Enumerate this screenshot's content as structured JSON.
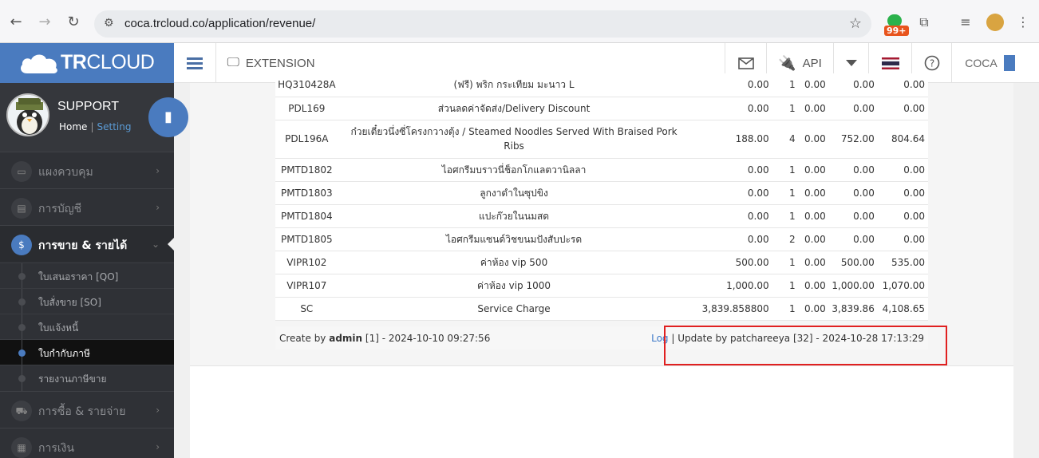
{
  "browser": {
    "url": "coca.trcloud.co/application/revenue/",
    "badge": "99+"
  },
  "header": {
    "logo_bold": "TR",
    "logo_thin": "CLOUD",
    "extension_label": "EXTENSION",
    "api_label": "API",
    "company_label": "COCA"
  },
  "user": {
    "name": "SUPPORT",
    "home_label": "Home",
    "separator": "|",
    "setting_label": "Setting"
  },
  "sidebar": {
    "items": [
      {
        "label": "แผงควบคุม",
        "icon": "monitor-icon"
      },
      {
        "label": "การบัญชี",
        "icon": "book-icon"
      },
      {
        "label": "การขาย & รายได้",
        "icon": "dollar-icon"
      },
      {
        "label": "การซื้อ & รายจ่าย",
        "icon": "cart-icon"
      },
      {
        "label": "การเงิน",
        "icon": "calendar-icon"
      }
    ],
    "sub_items": [
      {
        "label": "ใบเสนอราคา [QO]"
      },
      {
        "label": "ใบสั่งขาย [SO]"
      },
      {
        "label": "ใบแจ้งหนี้"
      },
      {
        "label": "ใบกำกับภาษี"
      },
      {
        "label": "รายงานภาษีขาย"
      }
    ]
  },
  "table": {
    "rows": [
      {
        "code": "HQ310428A",
        "desc": "(ฟรี) พริก กระเทียม มะนาว L",
        "price": "0.00",
        "qty": "1",
        "disc": "0.00",
        "amount": "0.00",
        "total": "0.00"
      },
      {
        "code": "PDL169",
        "desc": "ส่วนลดค่าจัดส่ง/Delivery Discount",
        "price": "0.00",
        "qty": "1",
        "disc": "0.00",
        "amount": "0.00",
        "total": "0.00"
      },
      {
        "code": "PDL196A",
        "desc": "ก๋วยเตี๋ยวนึ่งซี่โครงกวางตุ้ง / Steamed Noodles Served With Braised Pork Ribs",
        "price": "188.00",
        "qty": "4",
        "disc": "0.00",
        "amount": "752.00",
        "total": "804.64"
      },
      {
        "code": "PMTD1802",
        "desc": "ไอศกรีมบราวนี่ช็อกโกแลตวานิลลา",
        "price": "0.00",
        "qty": "1",
        "disc": "0.00",
        "amount": "0.00",
        "total": "0.00"
      },
      {
        "code": "PMTD1803",
        "desc": "ลูกงาดำในซุปขิง",
        "price": "0.00",
        "qty": "1",
        "disc": "0.00",
        "amount": "0.00",
        "total": "0.00"
      },
      {
        "code": "PMTD1804",
        "desc": "แปะก๊วยในนมสด",
        "price": "0.00",
        "qty": "1",
        "disc": "0.00",
        "amount": "0.00",
        "total": "0.00"
      },
      {
        "code": "PMTD1805",
        "desc": "ไอศกรีมแซนด์วิชขนมปังสับปะรด",
        "price": "0.00",
        "qty": "2",
        "disc": "0.00",
        "amount": "0.00",
        "total": "0.00"
      },
      {
        "code": "VIPR102",
        "desc": "ค่าห้อง vip 500",
        "price": "500.00",
        "qty": "1",
        "disc": "0.00",
        "amount": "500.00",
        "total": "535.00"
      },
      {
        "code": "VIPR107",
        "desc": "ค่าห้อง vip 1000",
        "price": "1,000.00",
        "qty": "1",
        "disc": "0.00",
        "amount": "1,000.00",
        "total": "1,070.00"
      },
      {
        "code": "SC",
        "desc": "Service Charge",
        "price": "3,839.858800",
        "qty": "1",
        "disc": "0.00",
        "amount": "3,839.86",
        "total": "4,108.65"
      }
    ]
  },
  "footer": {
    "create_prefix": "Create by",
    "create_user": "admin",
    "create_rest": "[1] - 2024-10-10 09:27:56",
    "log_label": "Log",
    "update_text": "| Update by patchareeya [32] - 2024-10-28 17:13:29"
  }
}
